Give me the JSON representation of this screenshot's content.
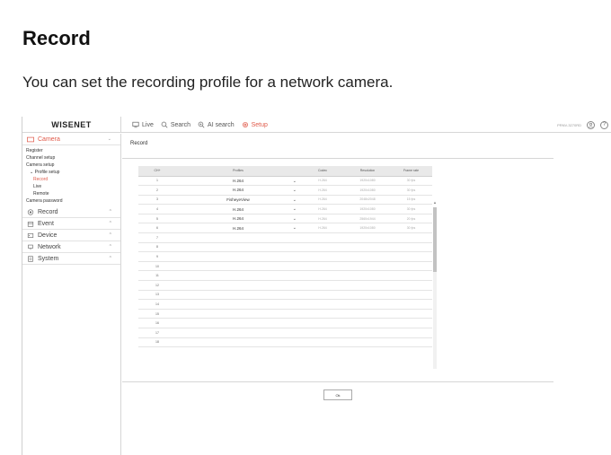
{
  "doc": {
    "heading": "Record",
    "description": "You can set the recording profile for a network camera."
  },
  "topbar": {
    "logo": "WISENET",
    "nav": [
      {
        "label": "Live",
        "icon": "monitor-icon",
        "active": false
      },
      {
        "label": "Search",
        "icon": "search-icon",
        "active": false
      },
      {
        "label": "AI search",
        "icon": "ai-search-icon",
        "active": true
      },
      {
        "label": "Setup",
        "icon": "gear-icon",
        "active": true
      }
    ],
    "model": "PRNV-3270RD",
    "icons": [
      "user-icon",
      "help-icon"
    ],
    "accent": "#e05a4a"
  },
  "sidebar": {
    "menus": [
      {
        "label": "Camera",
        "icon": "camera-icon",
        "active": true,
        "items": [
          {
            "label": "Register",
            "level": 1,
            "active": false
          },
          {
            "label": "Channel setup",
            "level": 1,
            "active": false
          },
          {
            "label": "Camera setup",
            "level": 1,
            "active": false
          },
          {
            "label": "Profile setup",
            "level": 1,
            "active": false
          },
          {
            "label": "Record",
            "level": 2,
            "active": true
          },
          {
            "label": "Live",
            "level": 2,
            "active": false
          },
          {
            "label": "Remote",
            "level": 2,
            "active": false
          },
          {
            "label": "Camera password",
            "level": 1,
            "active": false
          }
        ]
      },
      {
        "label": "Record",
        "icon": "record-icon"
      },
      {
        "label": "Event",
        "icon": "event-icon"
      },
      {
        "label": "Device",
        "icon": "device-icon"
      },
      {
        "label": "Network",
        "icon": "network-icon"
      },
      {
        "label": "System",
        "icon": "system-icon"
      }
    ]
  },
  "content": {
    "title": "Record",
    "columns": [
      "CH+",
      "Profiles",
      "Codec",
      "Resolution",
      "Frame rate"
    ],
    "rows": [
      {
        "ch": "1",
        "profile": "H.264",
        "codec": "H.264",
        "resolution": "1920x1080",
        "framerate": "30 fps"
      },
      {
        "ch": "2",
        "profile": "H.264",
        "codec": "H.264",
        "resolution": "1920x1080",
        "framerate": "30 fps"
      },
      {
        "ch": "3",
        "profile": "FisheyeView",
        "codec": "H.264",
        "resolution": "2048x2048",
        "framerate": "15 fps"
      },
      {
        "ch": "4",
        "profile": "H.264",
        "codec": "H.264",
        "resolution": "1920x1080",
        "framerate": "30 fps"
      },
      {
        "ch": "5",
        "profile": "H.264",
        "codec": "H.264",
        "resolution": "2560x1944",
        "framerate": "20 fps"
      },
      {
        "ch": "6",
        "profile": "H.264",
        "codec": "H.264",
        "resolution": "1920x1080",
        "framerate": "30 fps"
      },
      {
        "ch": "7"
      },
      {
        "ch": "8"
      },
      {
        "ch": "9"
      },
      {
        "ch": "10"
      },
      {
        "ch": "11"
      },
      {
        "ch": "12"
      },
      {
        "ch": "13"
      },
      {
        "ch": "14"
      },
      {
        "ch": "15"
      },
      {
        "ch": "16"
      },
      {
        "ch": "17"
      },
      {
        "ch": "18"
      }
    ],
    "ok_label": "Ok"
  }
}
